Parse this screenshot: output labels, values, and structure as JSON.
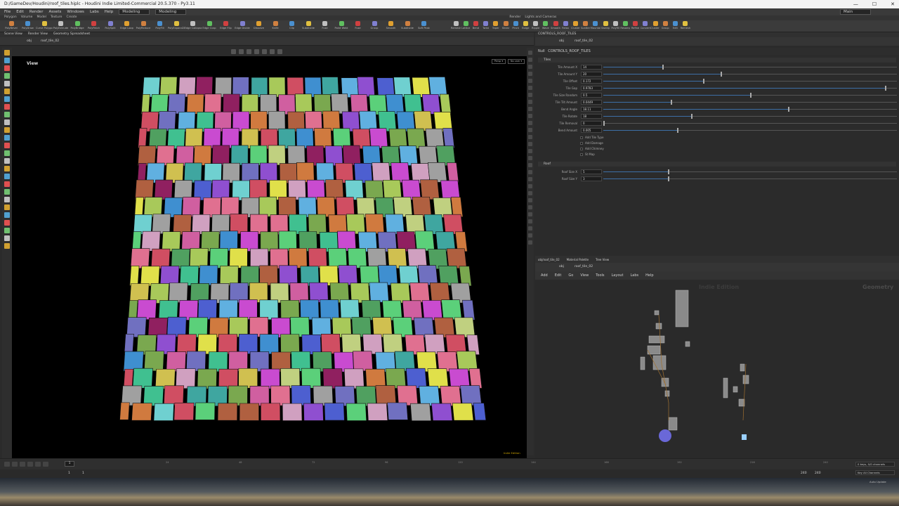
{
  "window": {
    "title": "D:/GameDev/Houdini/roof_tiles.hiplc - Houdini Indie Limited-Commercial 20.5.370 - Py3.11",
    "minimize": "—",
    "maximize": "☐",
    "close": "✕"
  },
  "menu": {
    "items": [
      "File",
      "Edit",
      "Render",
      "Assets",
      "Windows",
      "Labs",
      "Help"
    ],
    "desktop": "Modeling",
    "desktop2": "Modeling",
    "right": "Main"
  },
  "shelf": {
    "tabs": [
      "Polygon",
      "Volume",
      "Model",
      "Texture",
      "Create",
      "Render",
      "Lights and Cameras"
    ],
    "tools": [
      "PolyBevel",
      "PolyDraw",
      "Curve Polygon",
      "PolyExtrude",
      "PolyBridge",
      "PolyPatch",
      "PolySplit",
      "Edge Loop",
      "PolyReduce",
      "PolyFill",
      "PolyExpand2D",
      "Edge Collapse",
      "Edge Cusp",
      "Edge Flip",
      "Edge Divide",
      "Dissolve",
      "Knife",
      "Clip",
      "Subdivide",
      "Fuse",
      "Point Weld",
      "Fuse",
      "Group",
      "Smooth",
      "Subdivide",
      "Soft Peak"
    ],
    "tools_right": [
      "Remesh",
      "Lattice",
      "Bend",
      "Twist",
      "Taper",
      "Shear",
      "Pinch",
      "Bulge",
      "Ripple",
      "Wave",
      "Smooth",
      "Relax",
      "Cluster",
      "Scatter",
      "Mountain",
      "Sweep",
      "Polyfill",
      "Resample",
      "Refine",
      "Convert",
      "Cluster Points",
      "Group",
      "Edit",
      "Remesh"
    ]
  },
  "leftpane": {
    "tabs": [
      "Scene View",
      "Render View",
      "Geometry Spreadsheet"
    ],
    "path": "obj",
    "node": "roof_tile_02"
  },
  "viewport": {
    "label": "View",
    "persp": "Persp ▾",
    "cam": "No cam ▾",
    "edition": "Indie Edition"
  },
  "tiles": {
    "cols": 17,
    "rows": 20,
    "colors": [
      "#c94bd0",
      "#3fa6a0",
      "#7aa84f",
      "#d04e62",
      "#4d5fd0",
      "#a8c95a",
      "#e0e04a",
      "#5bd07a",
      "#d07a3f",
      "#a0a0a0",
      "#8f4fd0",
      "#3f8fd0",
      "#d0a0c0",
      "#6fd0d0",
      "#c0d080",
      "#d05fa0",
      "#50a060",
      "#b06040",
      "#7070c0",
      "#d0c050",
      "#40c090",
      "#902060",
      "#e07090",
      "#60b0e0"
    ]
  },
  "params": {
    "tab": "CONTROLS_ROOF_TILES",
    "node_type": "Null",
    "node_name": "CONTROLS_ROOF_TILES",
    "folders": [
      "Tiles",
      "Roof"
    ],
    "rows": [
      {
        "label": "Tile Amount X",
        "value": "14",
        "fill": 0.2
      },
      {
        "label": "Tile Amount Y",
        "value": "20",
        "fill": 0.4
      },
      {
        "label": "Tile Offset",
        "value": "0.172",
        "fill": 0.34
      },
      {
        "label": "Tile Gap",
        "value": "0.9783",
        "fill": 0.96
      },
      {
        "label": "Tile Size Random",
        "value": "0.5",
        "fill": 0.5
      },
      {
        "label": "Tile Tilt Amount",
        "value": "0.0449",
        "fill": 0.23
      },
      {
        "label": "Bend Angle",
        "value": "18.11",
        "fill": 0.63
      },
      {
        "label": "Tile Rotate",
        "value": "18",
        "fill": 0.3
      },
      {
        "label": "Tile Removal",
        "value": "0",
        "fill": 0.0
      },
      {
        "label": "Bend Amount",
        "value": "0.005",
        "fill": 0.25
      }
    ],
    "toggles": [
      "Add Tile Type",
      "Add Damage",
      "Add Chimney",
      "St Map"
    ],
    "roof_rows": [
      {
        "label": "Roof Size X",
        "value": "5",
        "fill": 0.22
      },
      {
        "label": "Roof Size Y",
        "value": "3",
        "fill": 0.22
      }
    ]
  },
  "network": {
    "tabs": [
      "obj/roof_tile_02",
      "Material Palette",
      "Tree View"
    ],
    "path": "obj",
    "node": "roof_tile_02",
    "menu": [
      "Add",
      "Edit",
      "Go",
      "View",
      "Tools",
      "Layout",
      "Labs",
      "Help"
    ],
    "title": "Indie Edition",
    "context": "Geometry"
  },
  "timeline": {
    "frame": "1",
    "start": "1",
    "start2": "1",
    "end": "240",
    "end2": "240",
    "ticks": [
      "24",
      "48",
      "72",
      "96",
      "120",
      "144",
      "168",
      "192",
      "216",
      "240"
    ],
    "keys": "0 keys, 0/0 channels",
    "channels": "Key All Channels",
    "auto": "Auto Update"
  }
}
